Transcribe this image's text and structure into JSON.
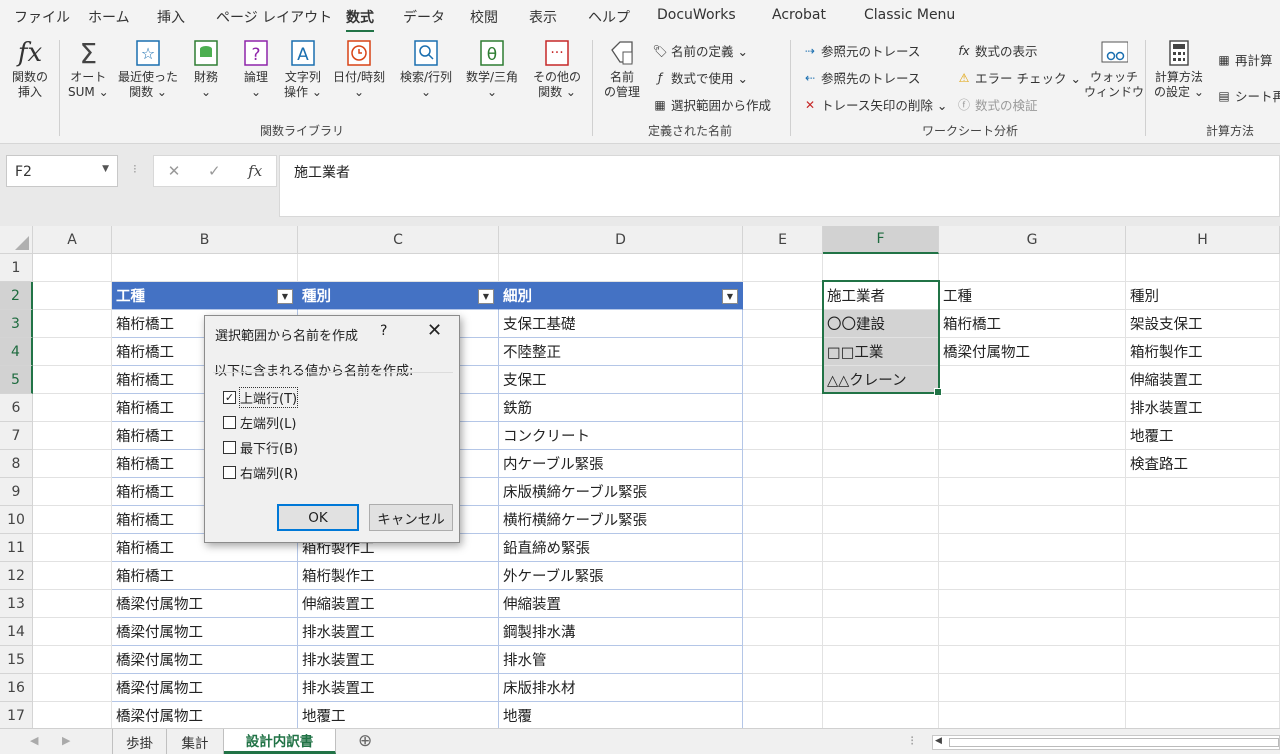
{
  "menu": [
    "ファイル",
    "ホーム",
    "挿入",
    "ページ レイアウト",
    "数式",
    "データ",
    "校閲",
    "表示",
    "ヘルプ",
    "DocuWorks",
    "Acrobat",
    "Classic Menu"
  ],
  "active_menu": "数式",
  "ribbon": {
    "insert_function": [
      "関数の",
      "挿入"
    ],
    "autosum": [
      "オート",
      "SUM ⌄"
    ],
    "recent": [
      "最近使った",
      "関数 ⌄"
    ],
    "financial": [
      "財務",
      "⌄"
    ],
    "logical": [
      "論理",
      "⌄"
    ],
    "text": [
      "文字列",
      "操作 ⌄"
    ],
    "datetime": [
      "日付/時刻",
      "⌄"
    ],
    "lookup": [
      "検索/行列",
      "⌄"
    ],
    "math": [
      "数学/三角",
      "⌄"
    ],
    "other": [
      "その他の",
      "関数 ⌄"
    ],
    "library_label": "関数ライブラリ",
    "name_manager": [
      "名前",
      "の管理"
    ],
    "define_name": "名前の定義 ⌄",
    "use_in_formula": "数式で使用 ⌄",
    "create_from_selection": "選択範囲から作成",
    "defined_names_label": "定義された名前",
    "trace_precedents": "参照元のトレース",
    "trace_dependents": "参照先のトレース",
    "remove_arrows": "トレース矢印の削除 ⌄",
    "show_formulas": "数式の表示",
    "error_check": "エラー チェック ⌄",
    "evaluate": "数式の検証",
    "watch_window": [
      "ウォッチ",
      "ウィンドウ"
    ],
    "auditing_label": "ワークシート分析",
    "calc_options": [
      "計算方法",
      "の設定 ⌄"
    ],
    "calc_now": "再計算",
    "calc_sheet": "シート再",
    "calc_label": "計算方法"
  },
  "namebox": "F2",
  "formula": "施工業者",
  "columns": [
    "A",
    "B",
    "C",
    "D",
    "E",
    "F",
    "G",
    "H"
  ],
  "rows": [
    "1",
    "2",
    "3",
    "4",
    "5",
    "6",
    "7",
    "8",
    "9",
    "10",
    "11",
    "12",
    "13",
    "14",
    "15",
    "16",
    "17"
  ],
  "table": {
    "headers": [
      "工種",
      "種別",
      "細別"
    ],
    "rows": [
      [
        "箱桁橋工",
        "",
        "支保工基礎"
      ],
      [
        "箱桁橋工",
        "",
        "不陸整正"
      ],
      [
        "箱桁橋工",
        "",
        "支保工"
      ],
      [
        "箱桁橋工",
        "",
        "鉄筋"
      ],
      [
        "箱桁橋工",
        "",
        "コンクリート"
      ],
      [
        "箱桁橋工",
        "",
        "内ケーブル緊張"
      ],
      [
        "箱桁橋工",
        "",
        "床版横締ケーブル緊張"
      ],
      [
        "箱桁橋工",
        "",
        "横桁横締ケーブル緊張"
      ],
      [
        "箱桁橋工",
        "箱桁製作工",
        "鉛直締め緊張"
      ],
      [
        "箱桁橋工",
        "箱桁製作工",
        "外ケーブル緊張"
      ],
      [
        "橋梁付属物工",
        "伸縮装置工",
        "伸縮装置"
      ],
      [
        "橋梁付属物工",
        "排水装置工",
        "鋼製排水溝"
      ],
      [
        "橋梁付属物工",
        "排水装置工",
        "排水管"
      ],
      [
        "橋梁付属物工",
        "排水装置工",
        "床版排水材"
      ],
      [
        "橋梁付属物工",
        "地覆工",
        "地覆"
      ]
    ]
  },
  "listF": [
    "施工業者",
    "〇〇建設",
    "□□工業",
    "△△クレーン"
  ],
  "listG": [
    "工種",
    "箱桁橋工",
    "橋梁付属物工"
  ],
  "listH": [
    "種別",
    "架設支保工",
    "箱桁製作工",
    "伸縮装置工",
    "排水装置工",
    "地覆工",
    "検査路工"
  ],
  "dialog": {
    "title": "選択範囲から名前を作成",
    "help": "?",
    "close": "✕",
    "prompt": "以下に含まれる値から名前を作成:",
    "options": [
      {
        "label": "上端行(T)",
        "checked": true
      },
      {
        "label": "左端列(L)",
        "checked": false
      },
      {
        "label": "最下行(B)",
        "checked": false
      },
      {
        "label": "右端列(R)",
        "checked": false
      }
    ],
    "ok": "OK",
    "cancel": "キャンセル"
  },
  "sheets": [
    "歩掛",
    "集計",
    "設計内訳書"
  ],
  "active_sheet": "設計内訳書"
}
